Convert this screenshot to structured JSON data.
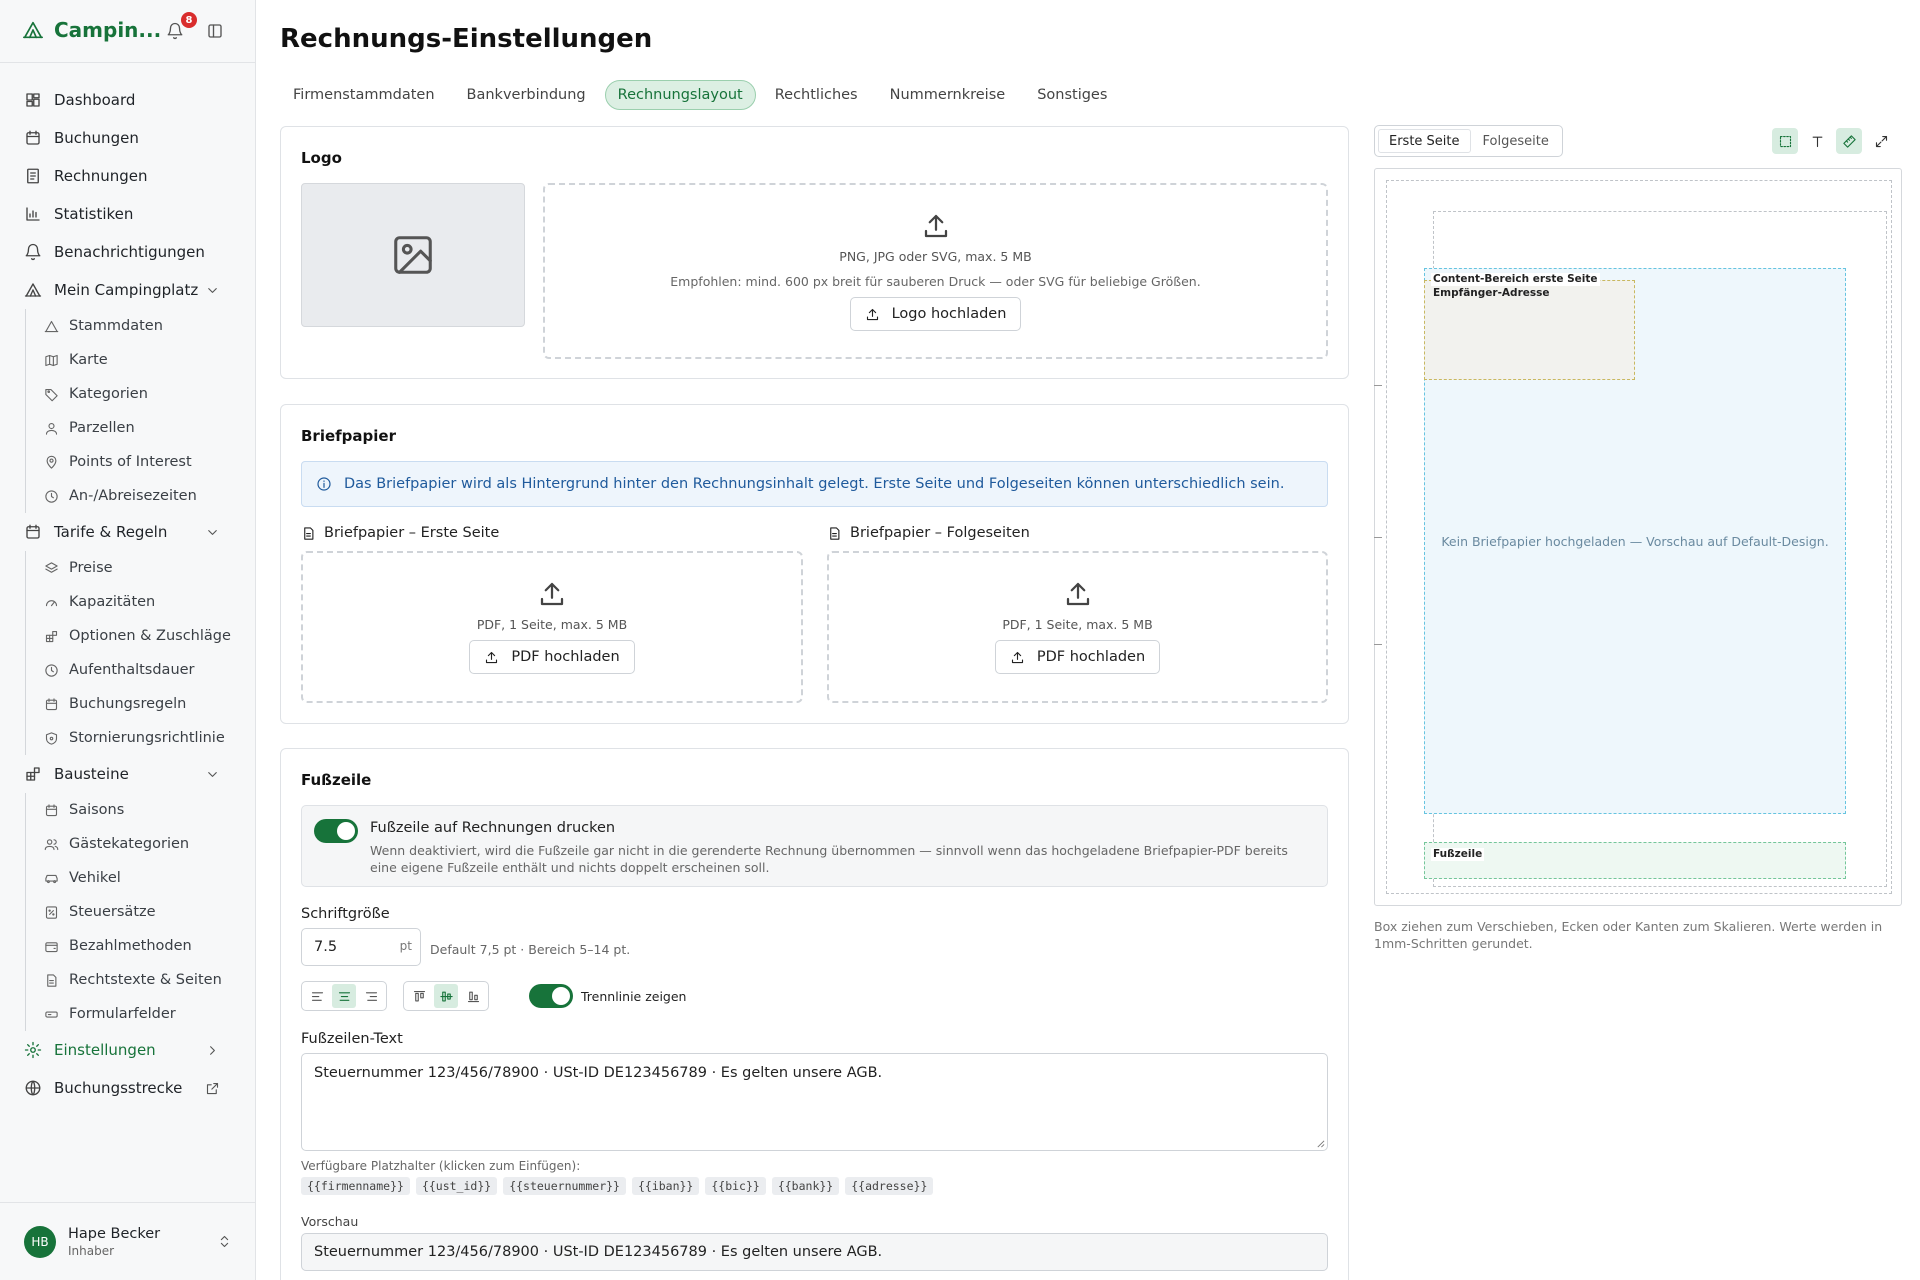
{
  "app": {
    "brand": "Campin...",
    "notification_count": "8"
  },
  "sidebar": {
    "items": [
      {
        "label": "Dashboard"
      },
      {
        "label": "Buchungen"
      },
      {
        "label": "Rechnungen"
      },
      {
        "label": "Statistiken"
      },
      {
        "label": "Benachrichtigungen"
      }
    ],
    "mein": {
      "label": "Mein Campingplatz",
      "sub": [
        "Stammdaten",
        "Karte",
        "Kategorien",
        "Parzellen",
        "Points of Interest",
        "An-/Abreisezeiten"
      ]
    },
    "tarife": {
      "label": "Tarife & Regeln",
      "sub": [
        "Preise",
        "Kapazitäten",
        "Optionen & Zuschläge",
        "Aufenthaltsdauer",
        "Buchungsregeln",
        "Stornierungsrichtlinie"
      ]
    },
    "bausteine": {
      "label": "Bausteine",
      "sub": [
        "Saisons",
        "Gästekategorien",
        "Vehikel",
        "Steuersätze",
        "Bezahlmethoden",
        "Rechtstexte & Seiten",
        "Formularfelder"
      ]
    },
    "einstellungen": {
      "label": "Einstellungen"
    },
    "buchungsstrecke": {
      "label": "Buchungsstrecke"
    },
    "user": {
      "initials": "HB",
      "name": "Hape Becker",
      "role": "Inhaber"
    }
  },
  "page": {
    "title": "Rechnungs-Einstellungen"
  },
  "tabs": [
    "Firmenstammdaten",
    "Bankverbindung",
    "Rechnungslayout",
    "Rechtliches",
    "Nummernkreise",
    "Sonstiges"
  ],
  "active_tab": "Rechnungslayout",
  "logo": {
    "title": "Logo",
    "formats": "PNG, JPG oder SVG, max. 5 MB",
    "recommendation": "Empfohlen: mind. 600 px breit für sauberen Druck — oder SVG für beliebige Größen.",
    "upload_label": "Logo hochladen"
  },
  "briefpapier": {
    "title": "Briefpapier",
    "info": "Das Briefpapier wird als Hintergrund hinter den Rechnungsinhalt gelegt. Erste Seite und Folgeseiten können unterschiedlich sein.",
    "first_label": "Briefpapier – Erste Seite",
    "follow_label": "Briefpapier – Folgeseiten",
    "formats": "PDF, 1 Seite, max. 5 MB",
    "upload_label": "PDF hochladen"
  },
  "footer": {
    "title": "Fußzeile",
    "print_label": "Fußzeile auf Rechnungen drucken",
    "print_hint": "Wenn deaktiviert, wird die Fußzeile gar nicht in die gerenderte Rechnung übernommen — sinnvoll wenn das hochgeladene Briefpapier-PDF bereits eine eigene Fußzeile enthält und nichts doppelt erscheinen soll.",
    "print_enabled": true,
    "font_size_label": "Schriftgröße",
    "font_size_value": "7.5",
    "font_size_unit": "pt",
    "font_size_hint": "Default 7,5 pt · Bereich 5–14 pt.",
    "alignment": "center",
    "vertical_alignment": "middle",
    "divider_label": "Trennlinie zeigen",
    "divider_enabled": true,
    "text_label": "Fußzeilen-Text",
    "text_value": "Steuernummer 123/456/78900 · USt-ID DE123456789 · Es gelten unsere AGB.",
    "placeholders_label": "Verfügbare Platzhalter (klicken zum Einfügen):",
    "placeholders": [
      "{{firmenname}}",
      "{{ust_id}}",
      "{{steuernummer}}",
      "{{iban}}",
      "{{bic}}",
      "{{bank}}",
      "{{adresse}}"
    ],
    "preview_label": "Vorschau",
    "preview_value": "Steuernummer 123/456/78900 · USt-ID DE123456789 · Es gelten unsere AGB."
  },
  "preview": {
    "pages": [
      "Erste Seite",
      "Folgeseite"
    ],
    "active_page": "Erste Seite",
    "content_label": "Content-Bereich erste Seite",
    "recipient_label": "Empfänger-Adresse",
    "empty_text": "Kein Briefpapier hochgeladen — Vorschau auf Default-Design.",
    "footer_label": "Fußzeile",
    "note": "Box ziehen zum Verschieben, Ecken oder Kanten zum Skalieren. Werte werden in 1mm-Schritten gerundet."
  },
  "colors": {
    "brand": "#17733a",
    "badge": "#d92d2d",
    "info": "#1f5a9c"
  }
}
